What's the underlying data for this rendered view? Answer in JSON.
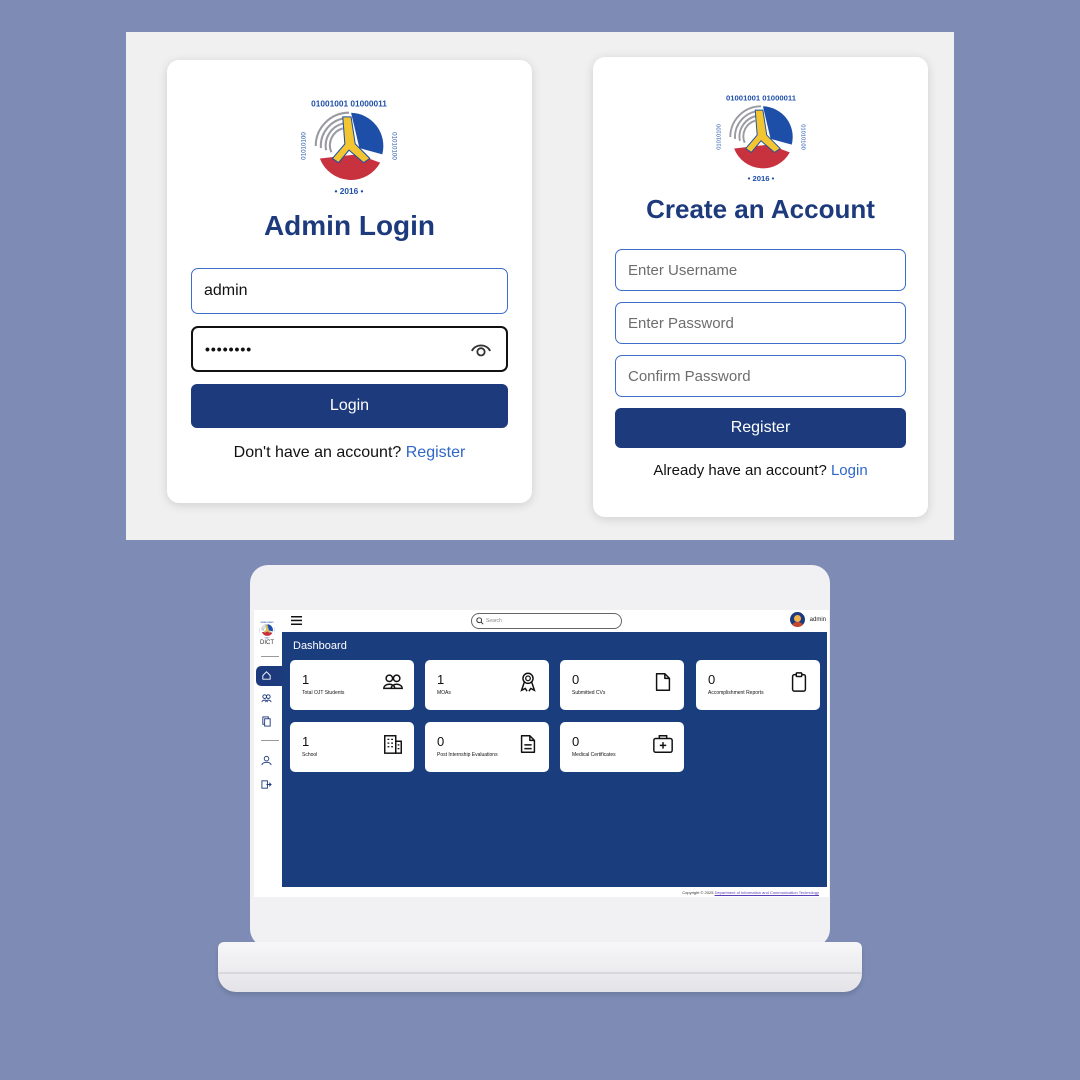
{
  "admin_login": {
    "title": "Admin Login",
    "username_value": "admin",
    "password_value": "••••••••",
    "login_button": "Login",
    "footer_text": "Don't have an account?",
    "footer_link": "Register"
  },
  "create_account": {
    "title": "Create an Account",
    "username_placeholder": "Enter Username",
    "password_placeholder": "Enter Password",
    "confirm_placeholder": "Confirm Password",
    "register_button": "Register",
    "footer_text": "Already have an account?",
    "footer_link": "Login"
  },
  "logo": {
    "binary_top": "01001001 01000011",
    "binary_left": "01010100",
    "binary_right": "01010100",
    "year": "2016"
  },
  "dashboard": {
    "sidebar_logo_text": "DICT",
    "search_placeholder": "Search",
    "user_name": "admin",
    "title": "Dashboard",
    "stats": [
      {
        "value": "1",
        "label": "Total OJT Students",
        "icon": "users-icon"
      },
      {
        "value": "1",
        "label": "MOAs",
        "icon": "award-icon"
      },
      {
        "value": "0",
        "label": "Submitted CVs",
        "icon": "document-icon"
      },
      {
        "value": "0",
        "label": "Accomplishment Reports",
        "icon": "clipboard-icon"
      },
      {
        "value": "1",
        "label": "School",
        "icon": "building-icon"
      },
      {
        "value": "0",
        "label": "Post Internship Evaluations",
        "icon": "document-lines-icon"
      },
      {
        "value": "0",
        "label": "Medical Certificates",
        "icon": "medical-kit-icon"
      }
    ],
    "copyright_text": "Copyright © 2025",
    "copyright_link": "Department of Information and Communication Technology"
  },
  "colors": {
    "background": "#7d8bb5",
    "brand_blue": "#1d3b7c",
    "link_blue": "#2f66c8"
  }
}
